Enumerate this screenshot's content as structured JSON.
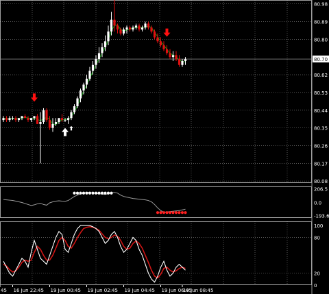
{
  "chart_data": {
    "type": "candlestick",
    "colors": {
      "background": "#000000",
      "grid": "#ffffff",
      "bull": "#ffffff",
      "bear": "#e01010",
      "ma": "#0ea20e",
      "cci": "#9c9c9c",
      "stoch_main": "#ffffff",
      "stoch_signal": "#d01515",
      "arrow_sell": "#ff1010",
      "arrow_buy": "#ffffff",
      "dot_up": "#ffffff",
      "dot_down": "#ff2020"
    },
    "price_panel": {
      "ylim": [
        80.07,
        81.0
      ],
      "y_ticks": [
        "80.98",
        "80.89",
        "80.80",
        "80.62",
        "80.53",
        "80.44",
        "80.35",
        "80.26",
        "80.17",
        "80.08"
      ],
      "current_price_label": "80.70",
      "current_price": 80.7,
      "candles": [
        [
          80.39,
          80.41,
          80.38,
          80.4
        ],
        [
          80.4,
          80.41,
          80.38,
          80.39
        ],
        [
          80.39,
          80.41,
          80.38,
          80.4
        ],
        [
          80.4,
          80.41,
          80.39,
          80.4
        ],
        [
          80.4,
          80.41,
          80.38,
          80.39
        ],
        [
          80.39,
          80.4,
          80.38,
          80.4
        ],
        [
          80.4,
          80.41,
          80.39,
          80.41
        ],
        [
          80.41,
          80.42,
          80.4,
          80.4
        ],
        [
          80.4,
          80.41,
          80.38,
          80.39
        ],
        [
          80.39,
          80.4,
          80.38,
          80.4
        ],
        [
          80.4,
          80.41,
          80.39,
          80.41
        ],
        [
          80.41,
          80.42,
          80.37,
          80.37
        ],
        [
          80.37,
          80.43,
          80.17,
          80.38
        ],
        [
          80.38,
          80.45,
          80.37,
          80.44
        ],
        [
          80.44,
          80.45,
          80.38,
          80.39
        ],
        [
          80.39,
          80.41,
          80.34,
          80.35
        ],
        [
          80.35,
          80.4,
          80.33,
          80.37
        ],
        [
          80.37,
          80.4,
          80.36,
          80.38
        ],
        [
          80.38,
          80.4,
          80.37,
          80.4
        ],
        [
          80.4,
          80.42,
          80.38,
          80.39
        ],
        [
          80.39,
          80.4,
          80.38,
          80.39
        ],
        [
          80.39,
          80.41,
          80.37,
          80.4
        ],
        [
          80.4,
          80.44,
          80.39,
          80.43
        ],
        [
          80.43,
          80.47,
          80.42,
          80.46
        ],
        [
          80.46,
          80.51,
          80.45,
          80.5
        ],
        [
          80.5,
          80.55,
          80.48,
          80.54
        ],
        [
          80.54,
          80.58,
          80.52,
          80.57
        ],
        [
          80.57,
          80.62,
          80.55,
          80.6
        ],
        [
          80.6,
          80.66,
          80.59,
          80.64
        ],
        [
          80.64,
          80.69,
          80.62,
          80.67
        ],
        [
          80.67,
          80.72,
          80.65,
          80.7
        ],
        [
          80.7,
          80.76,
          80.68,
          80.73
        ],
        [
          80.73,
          80.78,
          80.71,
          80.76
        ],
        [
          80.76,
          80.82,
          80.74,
          80.79
        ],
        [
          80.79,
          80.87,
          80.77,
          80.84
        ],
        [
          80.84,
          80.94,
          80.82,
          80.9
        ],
        [
          80.9,
          81.0,
          80.84,
          80.87
        ],
        [
          80.87,
          80.88,
          80.83,
          80.85
        ],
        [
          80.85,
          80.86,
          80.82,
          80.83
        ],
        [
          80.83,
          80.86,
          80.82,
          80.85
        ],
        [
          80.85,
          80.87,
          80.83,
          80.86
        ],
        [
          80.86,
          80.87,
          80.84,
          80.85
        ],
        [
          80.85,
          80.87,
          80.84,
          80.86
        ],
        [
          80.86,
          80.88,
          80.85,
          80.87
        ],
        [
          80.87,
          80.88,
          80.84,
          80.85
        ],
        [
          80.85,
          80.87,
          80.84,
          80.86
        ],
        [
          80.86,
          80.89,
          80.85,
          80.88
        ],
        [
          80.88,
          80.89,
          80.85,
          80.86
        ],
        [
          80.86,
          80.87,
          80.83,
          80.84
        ],
        [
          80.84,
          80.85,
          80.8,
          80.81
        ],
        [
          80.81,
          80.83,
          80.78,
          80.79
        ],
        [
          80.79,
          80.81,
          80.76,
          80.77
        ],
        [
          80.77,
          80.79,
          80.74,
          80.75
        ],
        [
          80.75,
          80.77,
          80.72,
          80.73
        ],
        [
          80.73,
          80.75,
          80.7,
          80.71
        ],
        [
          80.71,
          80.74,
          80.69,
          80.72
        ],
        [
          80.72,
          80.74,
          80.69,
          80.7
        ],
        [
          80.7,
          80.72,
          80.66,
          80.67
        ],
        [
          80.67,
          80.7,
          80.66,
          80.69
        ],
        [
          80.69,
          80.71,
          80.67,
          80.7
        ]
      ],
      "sell_arrows_at_candle": [
        10,
        53
      ],
      "buy_arrows_at_candle": [
        20,
        22
      ]
    },
    "cci_panel": {
      "ylim": [
        -230,
        240
      ],
      "y_ticks": [
        "206.5",
        "0.0",
        "-193.6"
      ],
      "values": [
        45,
        40,
        35,
        30,
        20,
        10,
        0,
        -15,
        -30,
        -45,
        -35,
        -20,
        -10,
        -30,
        -40,
        -5,
        10,
        20,
        25,
        20,
        18,
        30,
        60,
        90,
        110,
        130,
        140,
        150,
        150,
        140,
        135,
        130,
        125,
        120,
        130,
        145,
        150,
        140,
        110,
        90,
        80,
        70,
        60,
        55,
        50,
        45,
        40,
        30,
        10,
        -30,
        -80,
        -120,
        -145,
        -140,
        -135,
        -130,
        -125,
        -120,
        -110,
        -100
      ],
      "up_dots_range": [
        23,
        35
      ],
      "down_dots_range": [
        50,
        59
      ]
    },
    "stoch_panel": {
      "ylim": [
        0,
        107
      ],
      "y_ticks": [
        "100",
        "80",
        "20",
        "0"
      ],
      "main": [
        40,
        30,
        20,
        15,
        25,
        35,
        45,
        40,
        30,
        55,
        75,
        60,
        45,
        40,
        35,
        50,
        65,
        80,
        90,
        85,
        60,
        55,
        70,
        85,
        95,
        100,
        100,
        100,
        100,
        98,
        95,
        90,
        80,
        70,
        75,
        85,
        90,
        80,
        65,
        55,
        60,
        70,
        80,
        75,
        60,
        50,
        35,
        20,
        10,
        5,
        15,
        30,
        40,
        25,
        15,
        20,
        30,
        35,
        30,
        25
      ],
      "signal": [
        35,
        32,
        26,
        22,
        24,
        30,
        38,
        42,
        40,
        42,
        55,
        65,
        60,
        50,
        42,
        42,
        50,
        62,
        75,
        80,
        75,
        65,
        62,
        70,
        80,
        88,
        95,
        97,
        98,
        97,
        95,
        92,
        86,
        80,
        78,
        80,
        84,
        82,
        75,
        65,
        60,
        62,
        70,
        74,
        70,
        62,
        50,
        38,
        25,
        15,
        12,
        18,
        28,
        30,
        25,
        22,
        24,
        28,
        30,
        28
      ]
    },
    "time_axis": {
      "labels": [
        "45",
        "16 Jun 22:45",
        "19 Jun 00:45",
        "19 Jun 02:45",
        "19 Jun 04:45",
        "19 Jun 06:45",
        "19 Jun 08:45"
      ],
      "label_candle_index": [
        0,
        3,
        15,
        27,
        39,
        51,
        58
      ]
    }
  }
}
